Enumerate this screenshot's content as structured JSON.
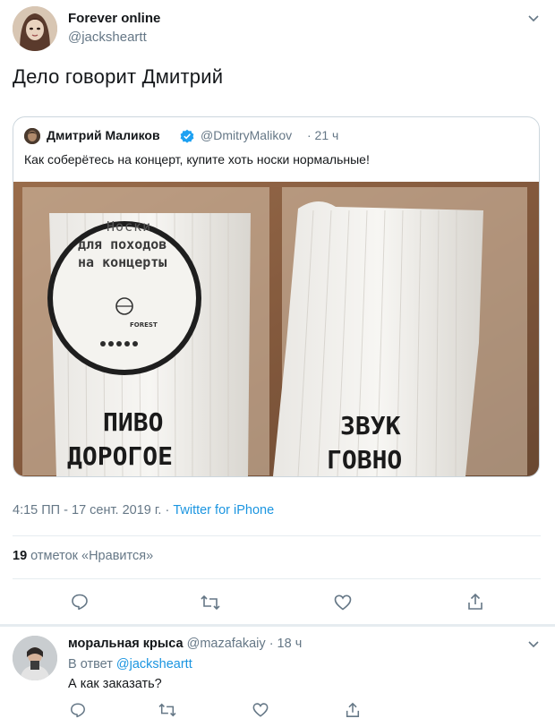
{
  "tweet": {
    "display_name": "Forever online",
    "handle": "@jacksheartt",
    "text": "Дело говорит Дмитрий",
    "time": "4:15 ПП",
    "date": "17 сент. 2019 г.",
    "separator": "·",
    "source": "Twitter for iPhone",
    "likes_count": "19",
    "likes_label": "отметок «Нравится»"
  },
  "quote": {
    "display_name": "Дмитрий Маликов",
    "handle": "@DmitryMalikov",
    "time": "· 21 ч",
    "text": "Как соберётесь на концерт, купите хоть носки нормальные!",
    "photo": {
      "tag_line1": "Носки",
      "tag_line2": "для походов",
      "tag_line3": "на концерты",
      "tag_brand": "FOREST",
      "sock1_line1": "ПИВО",
      "sock1_line2": "ДОРОГОЕ",
      "sock2_line1": "ЗВУК",
      "sock2_line2": "ГОВНО"
    }
  },
  "reply": {
    "display_name": "моральная крыса",
    "handle": "@mazafakaiy",
    "time": "· 18 ч",
    "reply_prefix": "В ответ",
    "reply_to": "@jacksheartt",
    "text": "А как заказать?"
  },
  "colors": {
    "accent": "#1b95e0",
    "text": "#14171a",
    "muted": "#657786",
    "border": "#e6ecf0",
    "verified": "#1da1f2"
  },
  "icons": [
    "chevron-down-icon",
    "verified-icon",
    "reply-icon",
    "retweet-icon",
    "like-icon",
    "share-icon"
  ]
}
